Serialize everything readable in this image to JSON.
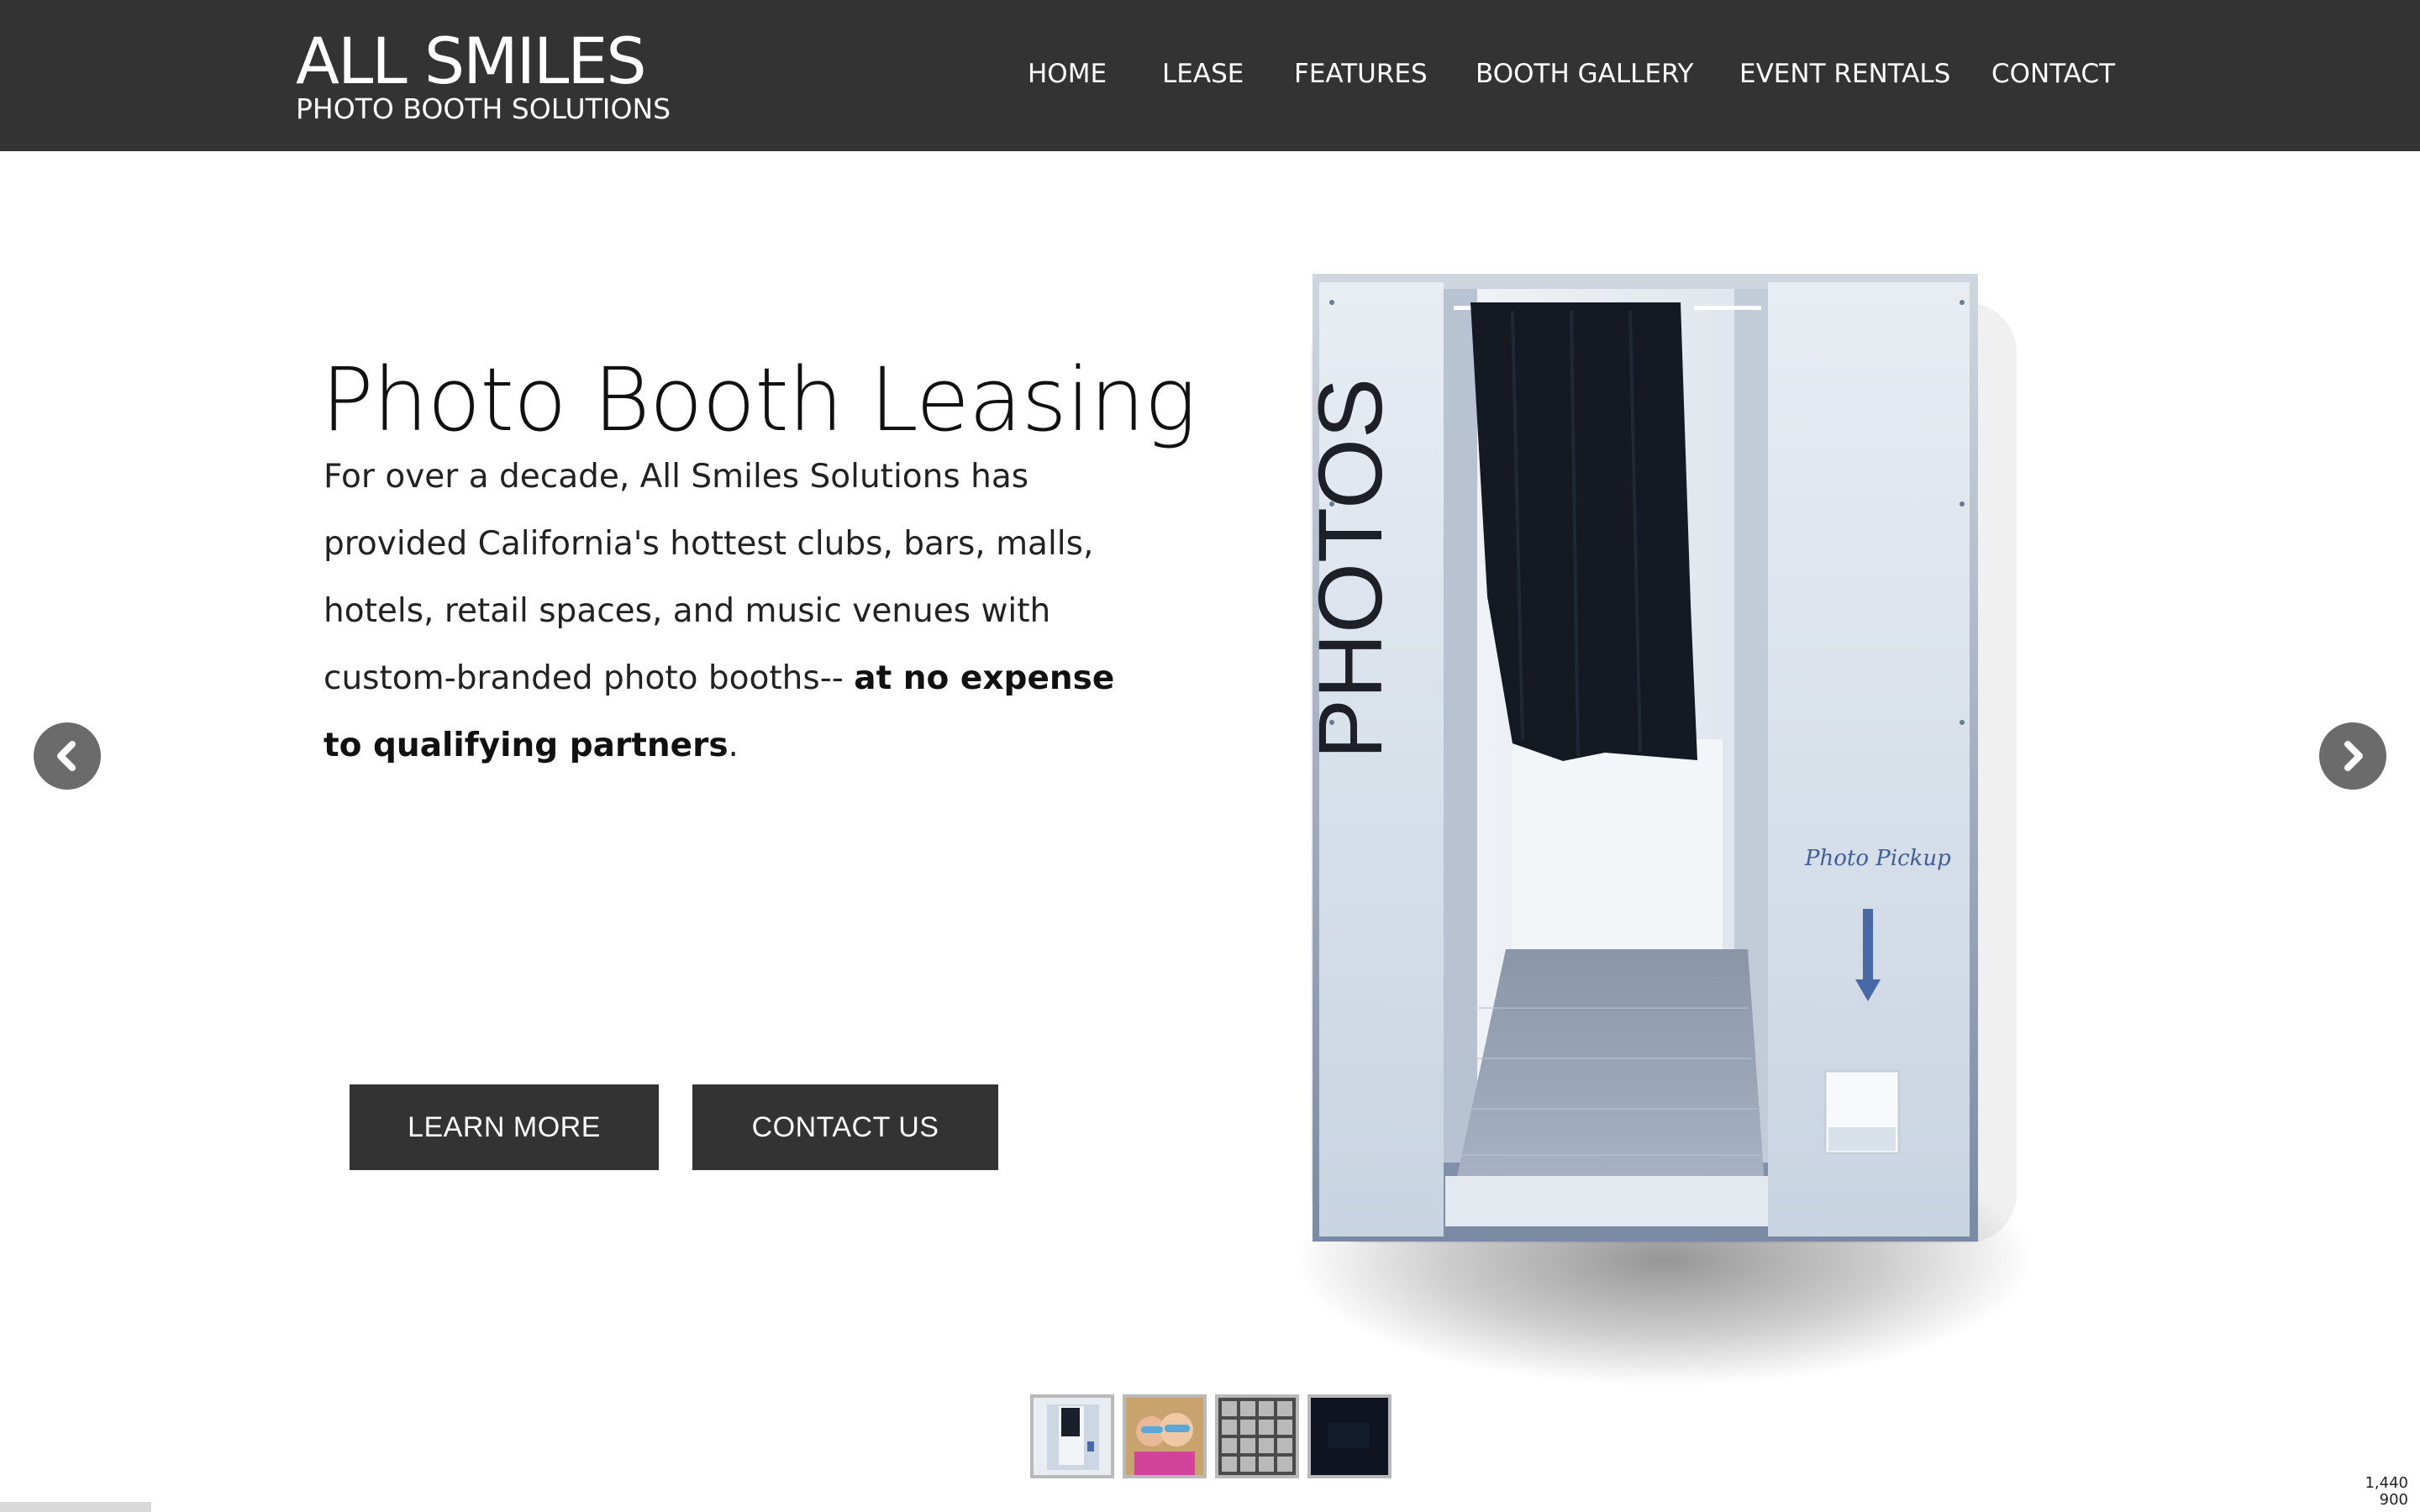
{
  "brand": {
    "title": "ALL SMILES",
    "subtitle": "PHOTO BOOTH SOLUTIONS"
  },
  "nav": {
    "items": [
      {
        "label": "HOME"
      },
      {
        "label": "LEASE"
      },
      {
        "label": "FEATURES"
      },
      {
        "label": "BOOTH GALLERY"
      },
      {
        "label": "EVENT RENTALS"
      },
      {
        "label": "CONTACT"
      }
    ]
  },
  "hero": {
    "title": "Photo Booth Leasing",
    "body": "For over a decade, All Smiles Solutions has provided California's hottest clubs, bars, malls, hotels, retail spaces, and music venues with custom-branded photo booths-- ",
    "emphasis": "at no expense to qualifying partners",
    "trailing": "."
  },
  "buttons": {
    "learn_more": "LEARN MORE",
    "contact_us": "CONTACT US"
  },
  "booth": {
    "side_text": "PHOTOS",
    "pickup_label": "Photo Pickup"
  },
  "carousel": {
    "prev_icon": "chevron-left-icon",
    "next_icon": "chevron-right-icon",
    "slide_count": 4,
    "active_slide": 1
  },
  "viewport_readout": {
    "width": "1,440",
    "height": "900"
  },
  "colors": {
    "header_bg": "#333333",
    "button_bg": "#333333",
    "arrow_bg": "#6b6b6b",
    "text_dark": "#111111"
  }
}
